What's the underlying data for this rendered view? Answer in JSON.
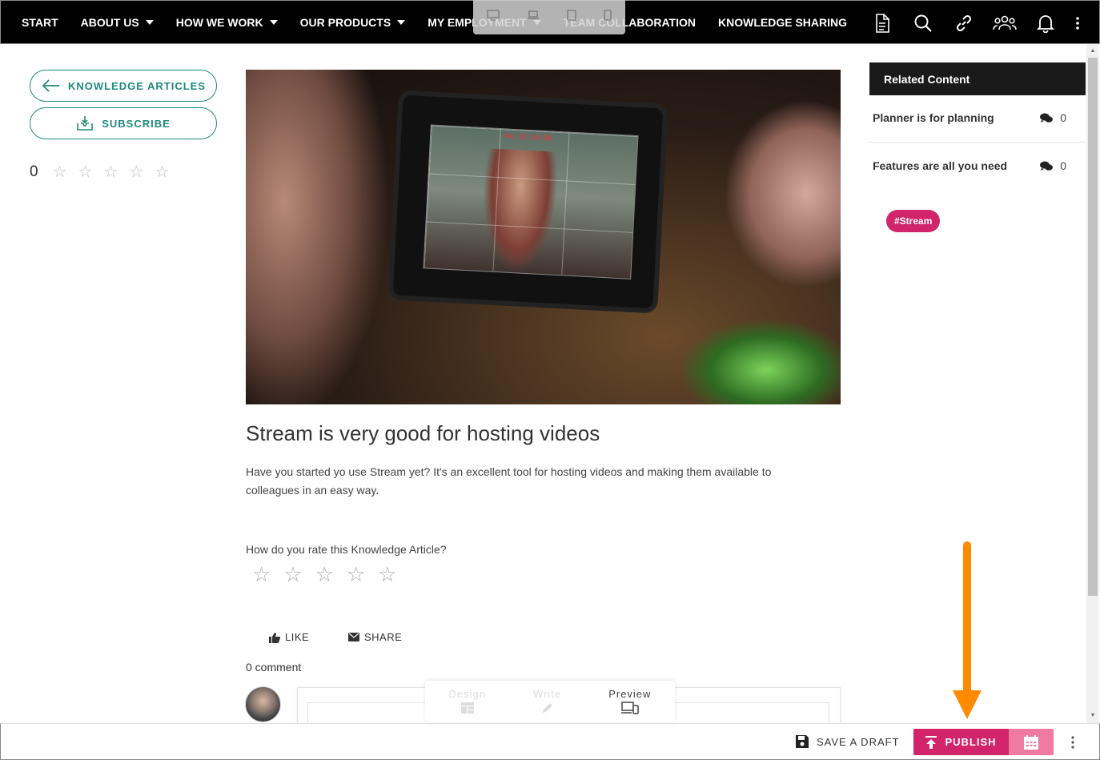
{
  "nav": {
    "items": [
      {
        "label": "START",
        "dropdown": false
      },
      {
        "label": "ABOUT US",
        "dropdown": true
      },
      {
        "label": "HOW WE WORK",
        "dropdown": true
      },
      {
        "label": "OUR PRODUCTS",
        "dropdown": true
      },
      {
        "label": "MY EMPLOYMENT",
        "dropdown": true
      },
      {
        "label": "TEAM COLLABORATION",
        "dropdown": false
      },
      {
        "label": "KNOWLEDGE SHARING",
        "dropdown": false
      }
    ],
    "icons": [
      "document-icon",
      "search-icon",
      "link-icon",
      "people-icon",
      "bell-icon",
      "more-vert-icon"
    ]
  },
  "left": {
    "back_label": "KNOWLEDGE ARTICLES",
    "subscribe_label": "SUBSCRIBE",
    "rating_value": "0"
  },
  "article": {
    "title": "Stream is very good for hosting videos",
    "body": "Have you started yo use Stream yet? It's an excellent tool for hosting videos and making them available to colleagues in an easy way.",
    "rate_question": "How do you rate this Knowledge Article?",
    "like_label": "LIKE",
    "share_label": "SHARE",
    "comment_count": "0 comment"
  },
  "hero": {
    "rec_time": "04:16:24:08"
  },
  "modes": [
    {
      "label": "Design",
      "active": false
    },
    {
      "label": "Write",
      "active": false
    },
    {
      "label": "Preview",
      "active": true
    }
  ],
  "related": {
    "heading": "Related Content",
    "items": [
      {
        "title": "Planner is for planning",
        "count": "0"
      },
      {
        "title": "Features are all you need",
        "count": "0"
      }
    ],
    "tag": "#Stream"
  },
  "bottom": {
    "save_label": "SAVE A DRAFT",
    "publish_label": "PUBLISH"
  },
  "colors": {
    "accent_teal": "#1f8a7a",
    "publish_pink": "#d1246b",
    "annotation_orange": "#ff8a00"
  }
}
